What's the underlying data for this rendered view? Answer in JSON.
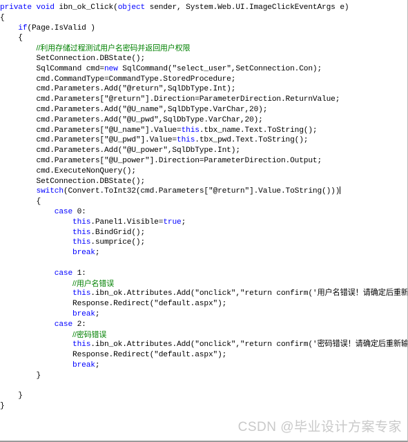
{
  "document": {
    "type": "source-code-screenshot",
    "language": "C#",
    "colors": {
      "background": "#ffffff",
      "text": "#000000",
      "keyword": "#0000ff",
      "comment": "#008000",
      "watermark": "#c9c9c9"
    }
  },
  "watermark": {
    "text": "CSDN @毕业设计方案专家"
  },
  "code": {
    "caret_line_index": 20,
    "lines": [
      {
        "n": 1,
        "indent": 0,
        "segments": [
          {
            "t": "kw",
            "v": "private"
          },
          {
            "t": "plain",
            "v": " "
          },
          {
            "t": "kw",
            "v": "void"
          },
          {
            "t": "plain",
            "v": " ibn_ok_Click("
          },
          {
            "t": "kw",
            "v": "object"
          },
          {
            "t": "plain",
            "v": " sender, System.Web.UI.ImageClickEventArgs e)"
          }
        ]
      },
      {
        "n": 2,
        "indent": 0,
        "segments": [
          {
            "t": "plain",
            "v": "{"
          }
        ]
      },
      {
        "n": 3,
        "indent": 1,
        "segments": [
          {
            "t": "kw",
            "v": "if"
          },
          {
            "t": "plain",
            "v": "(Page.IsValid )"
          }
        ]
      },
      {
        "n": 4,
        "indent": 1,
        "segments": [
          {
            "t": "plain",
            "v": "{"
          }
        ]
      },
      {
        "n": 5,
        "indent": 2,
        "segments": [
          {
            "t": "cmt",
            "v": "//利用存储过程测试用户名密码并返回用户权限"
          }
        ]
      },
      {
        "n": 6,
        "indent": 2,
        "segments": [
          {
            "t": "plain",
            "v": "SetConnection.DBState();"
          }
        ]
      },
      {
        "n": 7,
        "indent": 2,
        "segments": [
          {
            "t": "plain",
            "v": "SqlCommand cmd="
          },
          {
            "t": "kw",
            "v": "new"
          },
          {
            "t": "plain",
            "v": " SqlCommand(\"select_user\",SetConnection.Con);"
          }
        ]
      },
      {
        "n": 8,
        "indent": 2,
        "segments": [
          {
            "t": "plain",
            "v": "cmd.CommandType=CommandType.StoredProcedure;"
          }
        ]
      },
      {
        "n": 9,
        "indent": 2,
        "segments": [
          {
            "t": "plain",
            "v": "cmd.Parameters.Add(\"@return\",SqlDbType.Int);"
          }
        ]
      },
      {
        "n": 10,
        "indent": 2,
        "segments": [
          {
            "t": "plain",
            "v": "cmd.Parameters[\"@return\"].Direction=ParameterDirection.ReturnValue;"
          }
        ]
      },
      {
        "n": 11,
        "indent": 2,
        "segments": [
          {
            "t": "plain",
            "v": "cmd.Parameters.Add(\"@U_name\",SqlDbType.VarChar,20);"
          }
        ]
      },
      {
        "n": 12,
        "indent": 2,
        "segments": [
          {
            "t": "plain",
            "v": "cmd.Parameters.Add(\"@U_pwd\",SqlDbType.VarChar,20);"
          }
        ]
      },
      {
        "n": 13,
        "indent": 2,
        "segments": [
          {
            "t": "plain",
            "v": "cmd.Parameters[\"@U_name\"].Value="
          },
          {
            "t": "kw",
            "v": "this"
          },
          {
            "t": "plain",
            "v": ".tbx_name.Text.ToString();"
          }
        ]
      },
      {
        "n": 14,
        "indent": 2,
        "segments": [
          {
            "t": "plain",
            "v": "cmd.Parameters[\"@U_pwd\"].Value="
          },
          {
            "t": "kw",
            "v": "this"
          },
          {
            "t": "plain",
            "v": ".tbx_pwd.Text.ToString();"
          }
        ]
      },
      {
        "n": 15,
        "indent": 2,
        "segments": [
          {
            "t": "plain",
            "v": "cmd.Parameters.Add(\"@U_power\",SqlDbType.Int);"
          }
        ]
      },
      {
        "n": 16,
        "indent": 2,
        "segments": [
          {
            "t": "plain",
            "v": "cmd.Parameters[\"@U_power\"].Direction=ParameterDirection.Output;"
          }
        ]
      },
      {
        "n": 17,
        "indent": 2,
        "segments": [
          {
            "t": "plain",
            "v": "cmd.ExecuteNonQuery();"
          }
        ]
      },
      {
        "n": 18,
        "indent": 2,
        "segments": [
          {
            "t": "plain",
            "v": "SetConnection.DBState();"
          }
        ]
      },
      {
        "n": 19,
        "indent": 2,
        "segments": [
          {
            "t": "kw",
            "v": "switch"
          },
          {
            "t": "plain",
            "v": "(Convert.ToInt32(cmd.Parameters[\"@return\"].Value.ToString()))"
          },
          {
            "t": "caret",
            "v": ""
          }
        ]
      },
      {
        "n": 20,
        "indent": 2,
        "segments": [
          {
            "t": "plain",
            "v": "{"
          }
        ]
      },
      {
        "n": 21,
        "indent": 3,
        "segments": [
          {
            "t": "kw",
            "v": "case"
          },
          {
            "t": "plain",
            "v": " 0:"
          }
        ]
      },
      {
        "n": 22,
        "indent": 4,
        "segments": [
          {
            "t": "kw",
            "v": "this"
          },
          {
            "t": "plain",
            "v": ".Panel1.Visible="
          },
          {
            "t": "kw",
            "v": "true"
          },
          {
            "t": "plain",
            "v": ";"
          }
        ]
      },
      {
        "n": 23,
        "indent": 4,
        "segments": [
          {
            "t": "kw",
            "v": "this"
          },
          {
            "t": "plain",
            "v": ".BindGrid();"
          }
        ]
      },
      {
        "n": 24,
        "indent": 4,
        "segments": [
          {
            "t": "kw",
            "v": "this"
          },
          {
            "t": "plain",
            "v": ".sumprice();"
          }
        ]
      },
      {
        "n": 25,
        "indent": 4,
        "segments": [
          {
            "t": "kw",
            "v": "break"
          },
          {
            "t": "plain",
            "v": ";"
          }
        ]
      },
      {
        "n": 26,
        "indent": 0,
        "segments": []
      },
      {
        "n": 27,
        "indent": 3,
        "segments": [
          {
            "t": "kw",
            "v": "case"
          },
          {
            "t": "plain",
            "v": " 1:"
          }
        ]
      },
      {
        "n": 28,
        "indent": 4,
        "segments": [
          {
            "t": "cmt",
            "v": "//用户名错误"
          }
        ]
      },
      {
        "n": 29,
        "indent": 4,
        "segments": [
          {
            "t": "kw",
            "v": "this"
          },
          {
            "t": "plain",
            "v": ".ibn_ok.Attributes.Add(\"onclick\",\"return confirm('用户名错误！请确定后重新输入')\");"
          }
        ]
      },
      {
        "n": 30,
        "indent": 4,
        "segments": [
          {
            "t": "plain",
            "v": "Response.Redirect(\"default.aspx\");"
          }
        ]
      },
      {
        "n": 31,
        "indent": 4,
        "segments": [
          {
            "t": "kw",
            "v": "break"
          },
          {
            "t": "plain",
            "v": ";"
          }
        ]
      },
      {
        "n": 32,
        "indent": 3,
        "segments": [
          {
            "t": "kw",
            "v": "case"
          },
          {
            "t": "plain",
            "v": " 2:"
          }
        ]
      },
      {
        "n": 33,
        "indent": 4,
        "segments": [
          {
            "t": "cmt",
            "v": "//密码错误"
          }
        ]
      },
      {
        "n": 34,
        "indent": 4,
        "segments": [
          {
            "t": "kw",
            "v": "this"
          },
          {
            "t": "plain",
            "v": ".ibn_ok.Attributes.Add(\"onclick\",\"return confirm('密码错误！请确定后重新输入')\");"
          }
        ]
      },
      {
        "n": 35,
        "indent": 4,
        "segments": [
          {
            "t": "plain",
            "v": "Response.Redirect(\"default.aspx\");"
          }
        ]
      },
      {
        "n": 36,
        "indent": 4,
        "segments": [
          {
            "t": "kw",
            "v": "break"
          },
          {
            "t": "plain",
            "v": ";"
          }
        ]
      },
      {
        "n": 37,
        "indent": 2,
        "segments": [
          {
            "t": "plain",
            "v": "}"
          }
        ]
      },
      {
        "n": 38,
        "indent": 0,
        "segments": []
      },
      {
        "n": 39,
        "indent": 1,
        "segments": [
          {
            "t": "plain",
            "v": "}"
          }
        ]
      },
      {
        "n": 40,
        "indent": 0,
        "segments": [
          {
            "t": "plain",
            "v": "}"
          }
        ]
      }
    ]
  }
}
